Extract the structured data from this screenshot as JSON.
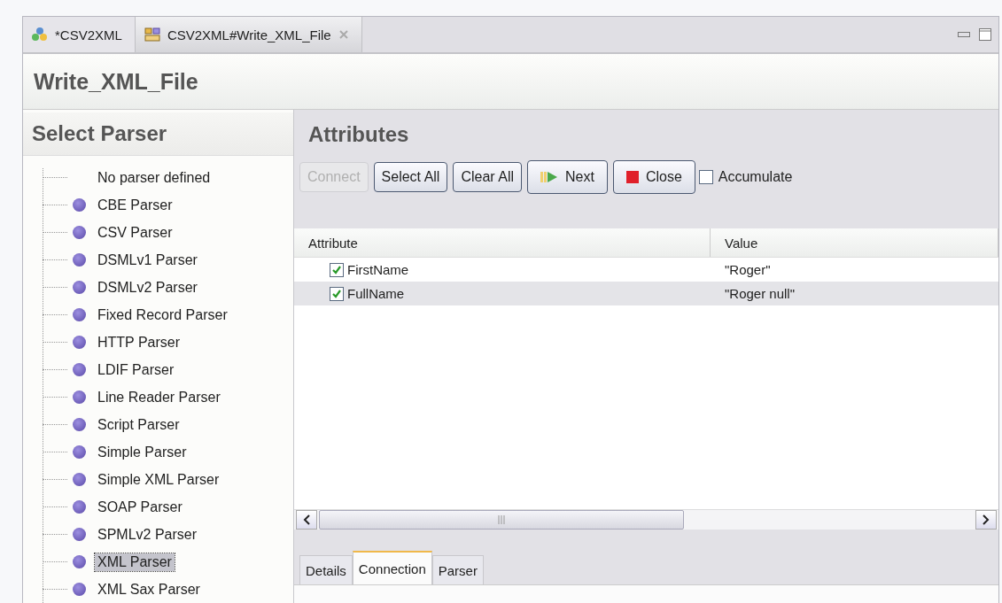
{
  "editor_tabs": [
    {
      "label": "*CSV2XML",
      "kind": "assembly",
      "selected": false
    },
    {
      "label": "CSV2XML#Write_XML_File",
      "kind": "component",
      "selected": true
    }
  ],
  "title": "Write_XML_File",
  "parser_panel": {
    "title": "Select Parser",
    "items": [
      {
        "label": "No parser defined",
        "kind": "none",
        "selected": false
      },
      {
        "label": "CBE Parser",
        "kind": "parser",
        "selected": false
      },
      {
        "label": "CSV Parser",
        "kind": "parser",
        "selected": false
      },
      {
        "label": "DSMLv1 Parser",
        "kind": "parser",
        "selected": false
      },
      {
        "label": "DSMLv2 Parser",
        "kind": "parser",
        "selected": false
      },
      {
        "label": "Fixed Record Parser",
        "kind": "parser",
        "selected": false
      },
      {
        "label": "HTTP Parser",
        "kind": "parser",
        "selected": false
      },
      {
        "label": "LDIF Parser",
        "kind": "parser",
        "selected": false
      },
      {
        "label": "Line Reader Parser",
        "kind": "parser",
        "selected": false
      },
      {
        "label": "Script Parser",
        "kind": "parser",
        "selected": false
      },
      {
        "label": "Simple Parser",
        "kind": "parser",
        "selected": false
      },
      {
        "label": "Simple XML Parser",
        "kind": "parser",
        "selected": false
      },
      {
        "label": "SOAP Parser",
        "kind": "parser",
        "selected": false
      },
      {
        "label": "SPMLv2 Parser",
        "kind": "parser",
        "selected": false
      },
      {
        "label": "XML Parser",
        "kind": "parser",
        "selected": true
      },
      {
        "label": "XML Sax Parser",
        "kind": "parser",
        "selected": false
      }
    ]
  },
  "attributes": {
    "title": "Attributes",
    "buttons": [
      {
        "label": "Connect",
        "kind": "plain",
        "disabled": true
      },
      {
        "label": "Select All",
        "kind": "plain",
        "disabled": false
      },
      {
        "label": "Clear All",
        "kind": "plain",
        "disabled": false
      },
      {
        "label": "Next",
        "kind": "next",
        "disabled": false
      },
      {
        "label": "Close",
        "kind": "close",
        "disabled": false
      }
    ],
    "accumulate": {
      "label": "Accumulate",
      "checked": false
    },
    "table": {
      "columns": [
        "Attribute",
        "Value"
      ],
      "rows": [
        {
          "attribute": "FirstName",
          "value": "\"Roger\"",
          "checked": true,
          "selected": false
        },
        {
          "attribute": "FullName",
          "value": "\"Roger null\"",
          "checked": true,
          "selected": true
        }
      ]
    },
    "bottom_tabs": [
      {
        "label": "Details",
        "selected": false
      },
      {
        "label": "Connection",
        "selected": true
      },
      {
        "label": "Parser",
        "selected": false
      }
    ]
  }
}
